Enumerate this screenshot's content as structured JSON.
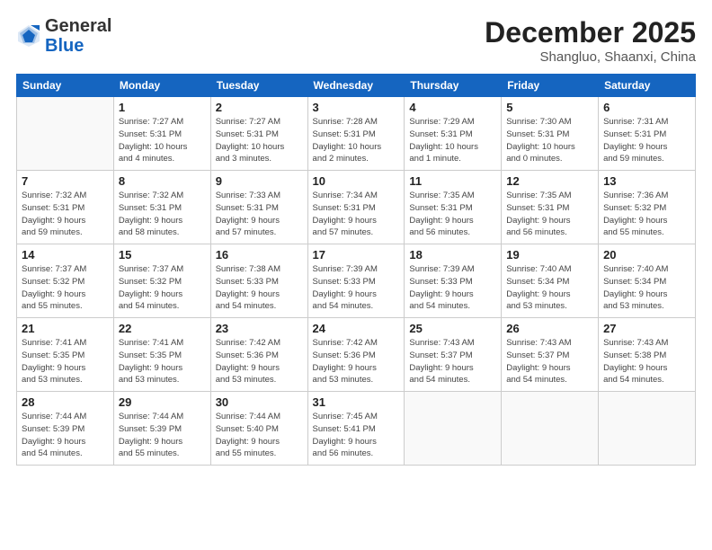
{
  "header": {
    "logo_general": "General",
    "logo_blue": "Blue",
    "month_year": "December 2025",
    "location": "Shangluo, Shaanxi, China"
  },
  "weekdays": [
    "Sunday",
    "Monday",
    "Tuesday",
    "Wednesday",
    "Thursday",
    "Friday",
    "Saturday"
  ],
  "weeks": [
    [
      {
        "day": "",
        "info": ""
      },
      {
        "day": "1",
        "info": "Sunrise: 7:27 AM\nSunset: 5:31 PM\nDaylight: 10 hours\nand 4 minutes."
      },
      {
        "day": "2",
        "info": "Sunrise: 7:27 AM\nSunset: 5:31 PM\nDaylight: 10 hours\nand 3 minutes."
      },
      {
        "day": "3",
        "info": "Sunrise: 7:28 AM\nSunset: 5:31 PM\nDaylight: 10 hours\nand 2 minutes."
      },
      {
        "day": "4",
        "info": "Sunrise: 7:29 AM\nSunset: 5:31 PM\nDaylight: 10 hours\nand 1 minute."
      },
      {
        "day": "5",
        "info": "Sunrise: 7:30 AM\nSunset: 5:31 PM\nDaylight: 10 hours\nand 0 minutes."
      },
      {
        "day": "6",
        "info": "Sunrise: 7:31 AM\nSunset: 5:31 PM\nDaylight: 9 hours\nand 59 minutes."
      }
    ],
    [
      {
        "day": "7",
        "info": "Sunrise: 7:32 AM\nSunset: 5:31 PM\nDaylight: 9 hours\nand 59 minutes."
      },
      {
        "day": "8",
        "info": "Sunrise: 7:32 AM\nSunset: 5:31 PM\nDaylight: 9 hours\nand 58 minutes."
      },
      {
        "day": "9",
        "info": "Sunrise: 7:33 AM\nSunset: 5:31 PM\nDaylight: 9 hours\nand 57 minutes."
      },
      {
        "day": "10",
        "info": "Sunrise: 7:34 AM\nSunset: 5:31 PM\nDaylight: 9 hours\nand 57 minutes."
      },
      {
        "day": "11",
        "info": "Sunrise: 7:35 AM\nSunset: 5:31 PM\nDaylight: 9 hours\nand 56 minutes."
      },
      {
        "day": "12",
        "info": "Sunrise: 7:35 AM\nSunset: 5:31 PM\nDaylight: 9 hours\nand 56 minutes."
      },
      {
        "day": "13",
        "info": "Sunrise: 7:36 AM\nSunset: 5:32 PM\nDaylight: 9 hours\nand 55 minutes."
      }
    ],
    [
      {
        "day": "14",
        "info": "Sunrise: 7:37 AM\nSunset: 5:32 PM\nDaylight: 9 hours\nand 55 minutes."
      },
      {
        "day": "15",
        "info": "Sunrise: 7:37 AM\nSunset: 5:32 PM\nDaylight: 9 hours\nand 54 minutes."
      },
      {
        "day": "16",
        "info": "Sunrise: 7:38 AM\nSunset: 5:33 PM\nDaylight: 9 hours\nand 54 minutes."
      },
      {
        "day": "17",
        "info": "Sunrise: 7:39 AM\nSunset: 5:33 PM\nDaylight: 9 hours\nand 54 minutes."
      },
      {
        "day": "18",
        "info": "Sunrise: 7:39 AM\nSunset: 5:33 PM\nDaylight: 9 hours\nand 54 minutes."
      },
      {
        "day": "19",
        "info": "Sunrise: 7:40 AM\nSunset: 5:34 PM\nDaylight: 9 hours\nand 53 minutes."
      },
      {
        "day": "20",
        "info": "Sunrise: 7:40 AM\nSunset: 5:34 PM\nDaylight: 9 hours\nand 53 minutes."
      }
    ],
    [
      {
        "day": "21",
        "info": "Sunrise: 7:41 AM\nSunset: 5:35 PM\nDaylight: 9 hours\nand 53 minutes."
      },
      {
        "day": "22",
        "info": "Sunrise: 7:41 AM\nSunset: 5:35 PM\nDaylight: 9 hours\nand 53 minutes."
      },
      {
        "day": "23",
        "info": "Sunrise: 7:42 AM\nSunset: 5:36 PM\nDaylight: 9 hours\nand 53 minutes."
      },
      {
        "day": "24",
        "info": "Sunrise: 7:42 AM\nSunset: 5:36 PM\nDaylight: 9 hours\nand 53 minutes."
      },
      {
        "day": "25",
        "info": "Sunrise: 7:43 AM\nSunset: 5:37 PM\nDaylight: 9 hours\nand 54 minutes."
      },
      {
        "day": "26",
        "info": "Sunrise: 7:43 AM\nSunset: 5:37 PM\nDaylight: 9 hours\nand 54 minutes."
      },
      {
        "day": "27",
        "info": "Sunrise: 7:43 AM\nSunset: 5:38 PM\nDaylight: 9 hours\nand 54 minutes."
      }
    ],
    [
      {
        "day": "28",
        "info": "Sunrise: 7:44 AM\nSunset: 5:39 PM\nDaylight: 9 hours\nand 54 minutes."
      },
      {
        "day": "29",
        "info": "Sunrise: 7:44 AM\nSunset: 5:39 PM\nDaylight: 9 hours\nand 55 minutes."
      },
      {
        "day": "30",
        "info": "Sunrise: 7:44 AM\nSunset: 5:40 PM\nDaylight: 9 hours\nand 55 minutes."
      },
      {
        "day": "31",
        "info": "Sunrise: 7:45 AM\nSunset: 5:41 PM\nDaylight: 9 hours\nand 56 minutes."
      },
      {
        "day": "",
        "info": ""
      },
      {
        "day": "",
        "info": ""
      },
      {
        "day": "",
        "info": ""
      }
    ]
  ]
}
